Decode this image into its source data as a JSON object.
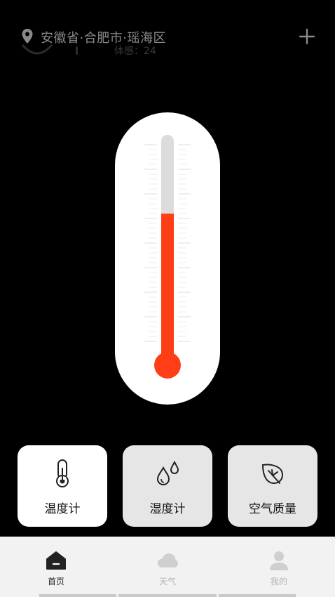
{
  "header": {
    "location": "安徽省·合肥市·瑶海区",
    "feels_like_partial": "体感：24"
  },
  "thermometer": {
    "fill_fraction": 0.66,
    "fill_color": "#ff3d17",
    "track_color": "#dcdcdc"
  },
  "cards": [
    {
      "label": "温度计",
      "icon": "thermometer-icon",
      "active": true
    },
    {
      "label": "湿度计",
      "icon": "droplets-icon",
      "active": false
    },
    {
      "label": "空气质量",
      "icon": "leaf-icon",
      "active": false
    }
  ],
  "tabs": [
    {
      "label": "首页",
      "icon": "home-icon",
      "active": true
    },
    {
      "label": "天气",
      "icon": "cloud-icon",
      "active": false
    },
    {
      "label": "我的",
      "icon": "user-icon",
      "active": false
    }
  ]
}
